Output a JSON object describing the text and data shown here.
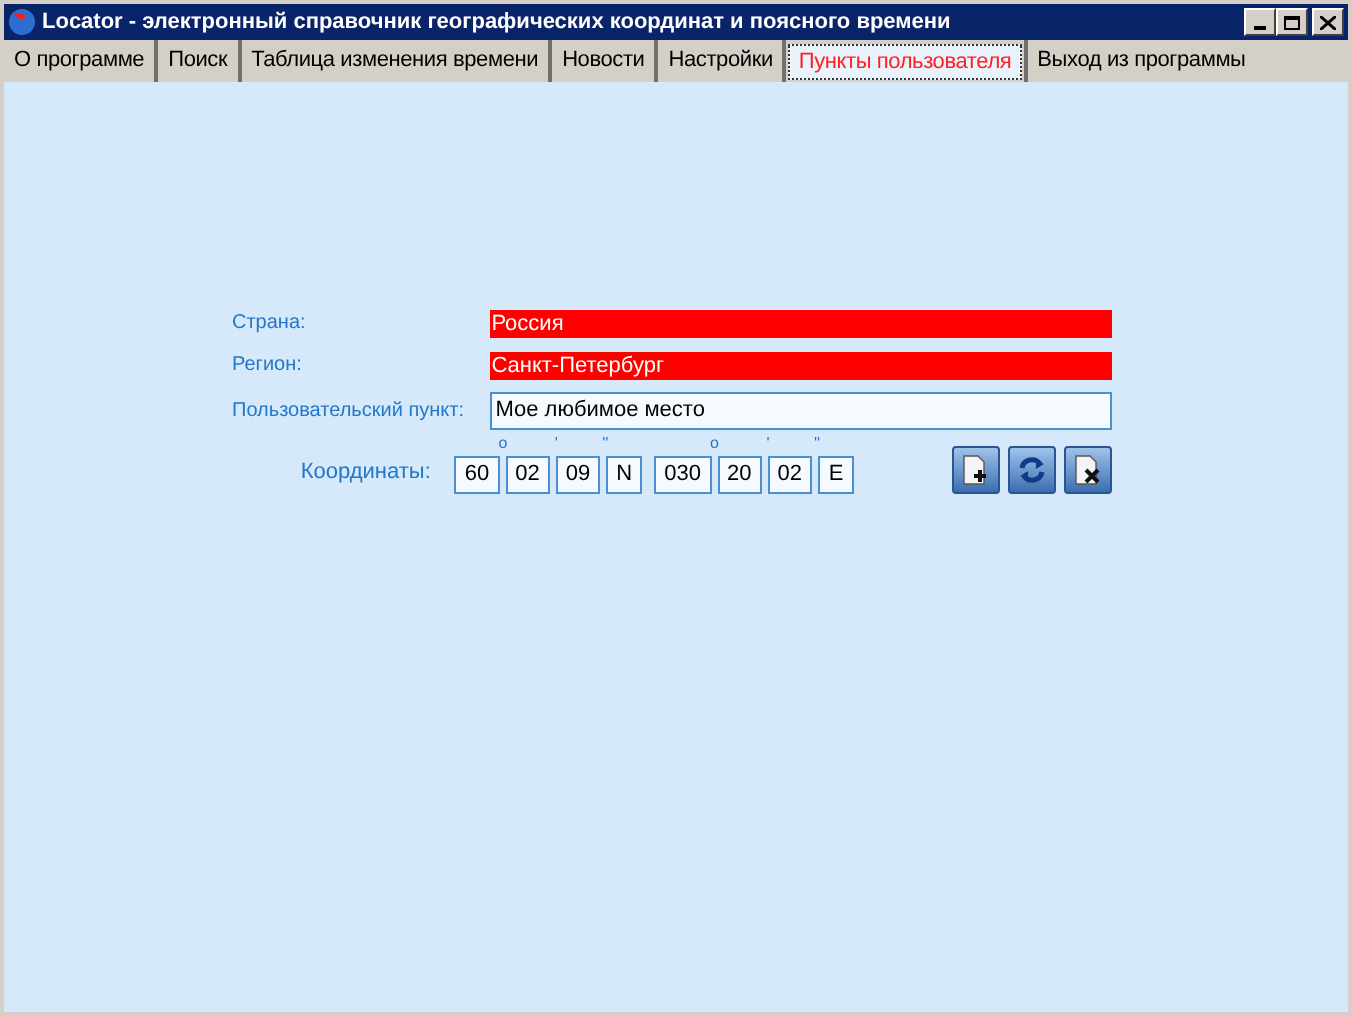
{
  "window": {
    "title": "Locator - электронный справочник географических координат и поясного времени"
  },
  "tabs": [
    {
      "label": "О программе",
      "selected": false
    },
    {
      "label": "Поиск",
      "selected": false
    },
    {
      "label": "Таблица изменения времени",
      "selected": false
    },
    {
      "label": "Новости",
      "selected": false
    },
    {
      "label": "Настройки",
      "selected": false
    },
    {
      "label": "Пункты пользователя",
      "selected": true
    },
    {
      "label": "Выход из программы",
      "selected": false
    }
  ],
  "form": {
    "fields": [
      {
        "label": "Страна:",
        "value": "Россия",
        "kind": "highlight"
      },
      {
        "label": "Регион:",
        "value": "Санкт-Петербург",
        "kind": "highlight"
      },
      {
        "label": "Пользовательский пункт:",
        "value": "Мое любимое место",
        "kind": "input"
      }
    ],
    "coordinates": {
      "label": "Координаты:",
      "parts": [
        {
          "value": "60",
          "mark": "o"
        },
        {
          "value": "02",
          "mark": "'"
        },
        {
          "value": "09",
          "mark": "''"
        },
        {
          "value": "N"
        },
        {
          "value": "030",
          "mark": "o",
          "gap": true
        },
        {
          "value": "20",
          "mark": "'"
        },
        {
          "value": "02",
          "mark": "''"
        },
        {
          "value": "E"
        }
      ]
    }
  }
}
